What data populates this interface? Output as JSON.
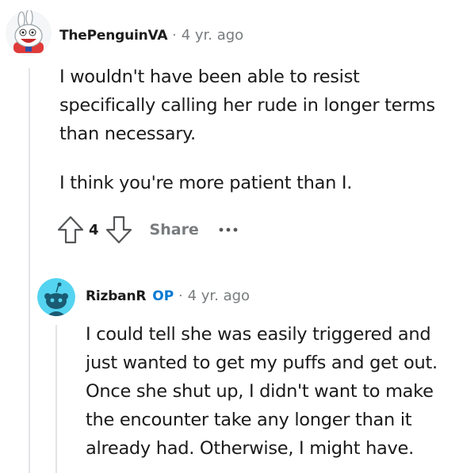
{
  "comment": {
    "author": "ThePenguinVA",
    "separator": "·",
    "time": "4 yr. ago",
    "paragraphs": [
      "I wouldn't have been able to resist specifically calling her rude in longer terms than necessary.",
      "I think you're more patient than I."
    ],
    "actions": {
      "score": "4",
      "share_label": "Share"
    }
  },
  "reply": {
    "author": "RizbanR",
    "op_badge": "OP",
    "separator": "·",
    "time": "4 yr. ago",
    "paragraphs": [
      "I could tell she was easily triggered and just wanted to get my puffs and get out. Once she shut up, I didn't want to make the encounter take any longer than it already had. Otherwise, I might have."
    ]
  },
  "icons": {
    "comment_avatar": "rabbid-avatar-icon",
    "reply_avatar": "snoo-avatar-icon",
    "upvote": "upvote-arrow-icon",
    "downvote": "downvote-arrow-icon",
    "more": "more-options-icon"
  },
  "colors": {
    "op": "#0079d3",
    "meta": "#787c7e",
    "thread_line": "#e2e4e6",
    "avatar_bg": "#54d4f0"
  }
}
